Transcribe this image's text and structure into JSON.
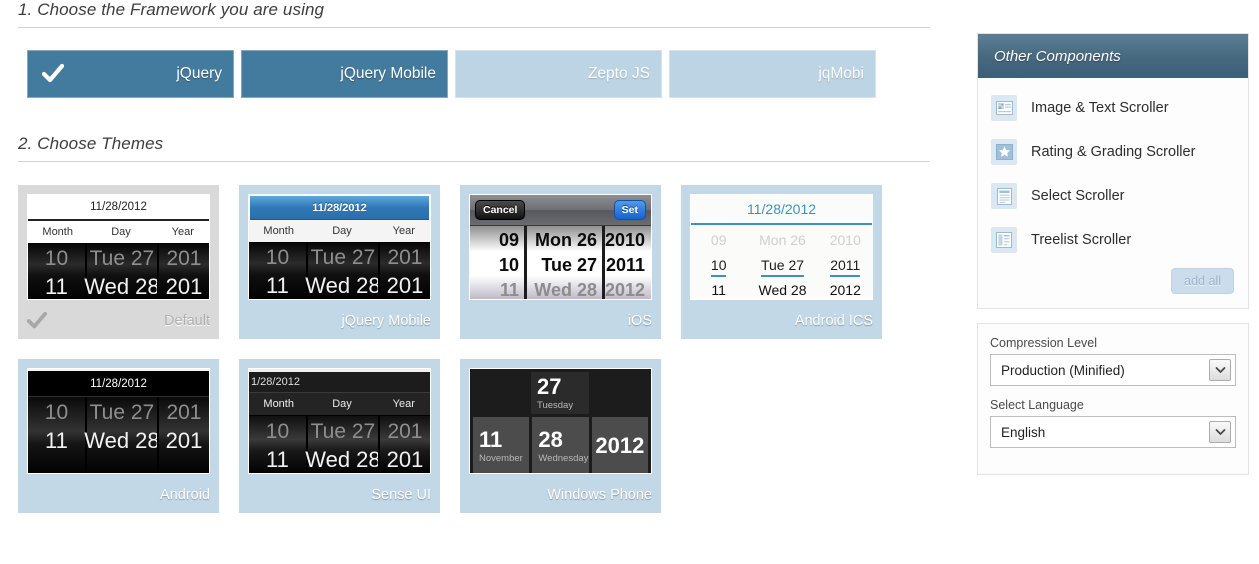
{
  "sections": {
    "framework": {
      "heading": "1. Choose the Framework you are using"
    },
    "themes": {
      "heading": "2. Choose Themes"
    }
  },
  "frameworks": [
    {
      "label": "jQuery",
      "selected": true
    },
    {
      "label": "jQuery Mobile",
      "selected": false
    },
    {
      "label": "Zepto JS",
      "selected": false
    },
    {
      "label": "jqMobi",
      "selected": false
    }
  ],
  "framework_state": {
    "jquery_active": true,
    "jquery_mobile_active": true,
    "zepto_active": false,
    "jqmobi_active": false
  },
  "themes": [
    {
      "name": "Default",
      "selected": true,
      "date": "11/28/2012",
      "labels": {
        "month": "Month",
        "day": "Day",
        "year": "Year"
      },
      "rows": [
        {
          "month": "10",
          "day": "Tue 27",
          "year": "201"
        },
        {
          "month": "11",
          "day": "Wed 28",
          "year": "201"
        }
      ]
    },
    {
      "name": "jQuery Mobile",
      "selected": false,
      "date": "11/28/2012",
      "labels": {
        "month": "Month",
        "day": "Day",
        "year": "Year"
      },
      "rows": [
        {
          "month": "10",
          "day": "Tue 27",
          "year": "201"
        },
        {
          "month": "11",
          "day": "Wed 28",
          "year": "201"
        }
      ]
    },
    {
      "name": "iOS",
      "selected": false,
      "cancel_label": "Cancel",
      "set_label": "Set",
      "rows": [
        {
          "month": "09",
          "day": "Mon 26",
          "year": "2010"
        },
        {
          "month": "10",
          "day": "Tue 27",
          "year": "2011"
        },
        {
          "month": "11",
          "day": "Wed 28",
          "year": "2012"
        }
      ]
    },
    {
      "name": "Android ICS",
      "selected": false,
      "date": "11/28/2012",
      "rows": [
        {
          "month": "09",
          "day": "Mon 26",
          "year": "2010"
        },
        {
          "month": "10",
          "day": "Tue 27",
          "year": "2011"
        },
        {
          "month": "11",
          "day": "Wed 28",
          "year": "2012"
        }
      ]
    },
    {
      "name": "Android",
      "selected": false,
      "date": "11/28/2012",
      "rows": [
        {
          "month": "10",
          "day": "Tue 27",
          "year": "201"
        },
        {
          "month": "11",
          "day": "Wed 28",
          "year": "201"
        }
      ]
    },
    {
      "name": "Sense UI",
      "selected": false,
      "date": "1/28/2012",
      "labels": {
        "month": "Month",
        "day": "Day",
        "year": "Year"
      },
      "rows": [
        {
          "month": "10",
          "day": "Tue 27",
          "year": "201"
        },
        {
          "month": "11",
          "day": "Wed 28",
          "year": "201"
        }
      ]
    },
    {
      "name": "Windows Phone",
      "selected": false,
      "tiles": {
        "top": {
          "num": "27",
          "sub": "Tuesday"
        },
        "month": {
          "num": "11",
          "sub": "November"
        },
        "day": {
          "num": "28",
          "sub": "Wednesday"
        },
        "year": {
          "num": "2012"
        }
      }
    }
  ],
  "sidebar": {
    "title": "Other Components",
    "items": [
      {
        "label": "Image & Text Scroller",
        "icon": "image-icon"
      },
      {
        "label": "Rating & Grading Scroller",
        "icon": "star-icon"
      },
      {
        "label": "Select Scroller",
        "icon": "list-icon"
      },
      {
        "label": "Treelist Scroller",
        "icon": "treelist-icon"
      }
    ],
    "add_all_label": "add all"
  },
  "options": {
    "compression": {
      "label": "Compression Level",
      "value": "Production (Minified)"
    },
    "language": {
      "label": "Select Language",
      "value": "English"
    }
  },
  "colors": {
    "accent_blue": "#437b9e",
    "inactive_blue": "#bcd4e3",
    "card_blue": "#c3d8e7",
    "card_selected_gray": "#d9d9d9",
    "panel_header": "#46687f",
    "ics_accent": "#3a92c4"
  }
}
